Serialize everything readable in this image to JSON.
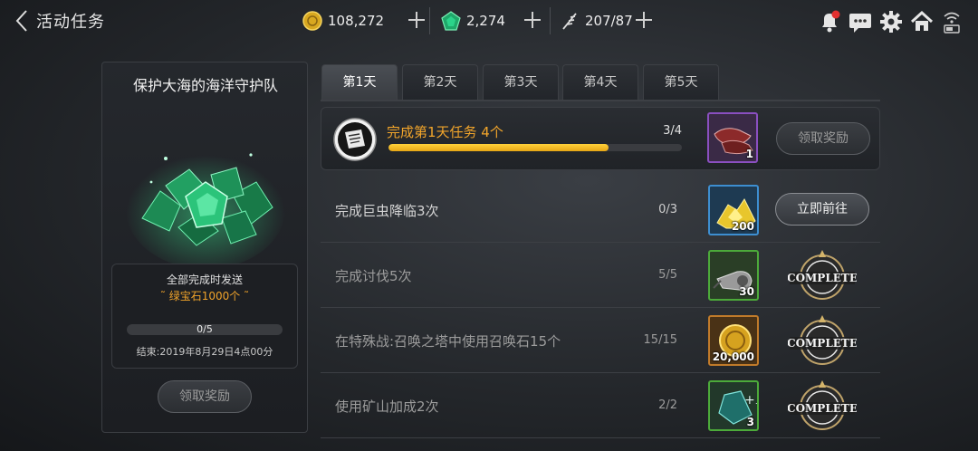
{
  "header": {
    "title": "活动任务",
    "gold": "108,272",
    "emerald": "2,274",
    "stamina": "207/87"
  },
  "event": {
    "title": "保护大海的海洋守护队",
    "reward_note": "全部完成时发送",
    "reward_item": "˜ 绿宝石1000个 ˜",
    "progress_text": "0/5",
    "progress": 0,
    "end_time": "结束:2019年8月29日4点00分",
    "claim_label": "领取奖励"
  },
  "tabs": [
    {
      "label": "第1天"
    },
    {
      "label": "第2天"
    },
    {
      "label": "第3天"
    },
    {
      "label": "第4天"
    },
    {
      "label": "第5天"
    }
  ],
  "main_task": {
    "title": "完成第1天任务  4个",
    "count": "3/4",
    "progress": 0.75,
    "reward_qty": "1",
    "button_label": "领取奖励"
  },
  "tasks": [
    {
      "name": "完成巨虫降临3次",
      "count": "0/3",
      "reward_qty": "200",
      "reward_icon": "gold-nugget-icon",
      "action": "立即前往"
    },
    {
      "name": "完成讨伐5次",
      "count": "5/5",
      "reward_qty": "30",
      "reward_icon": "whistle-icon",
      "action": "COMPLETE"
    },
    {
      "name": "在特殊战:召唤之塔中使用召唤石15个",
      "count": "15/15",
      "reward_qty": "20,000",
      "reward_icon": "gold-coin-icon",
      "action": "COMPLETE"
    },
    {
      "name": "使用矿山加成2次",
      "count": "2/2",
      "reward_qty": "3",
      "reward_icon": "mine-boost-potion-icon",
      "action": "COMPLETE"
    }
  ],
  "colors": {
    "accent": "#f2a52b",
    "progress": "#ffcc2e"
  }
}
